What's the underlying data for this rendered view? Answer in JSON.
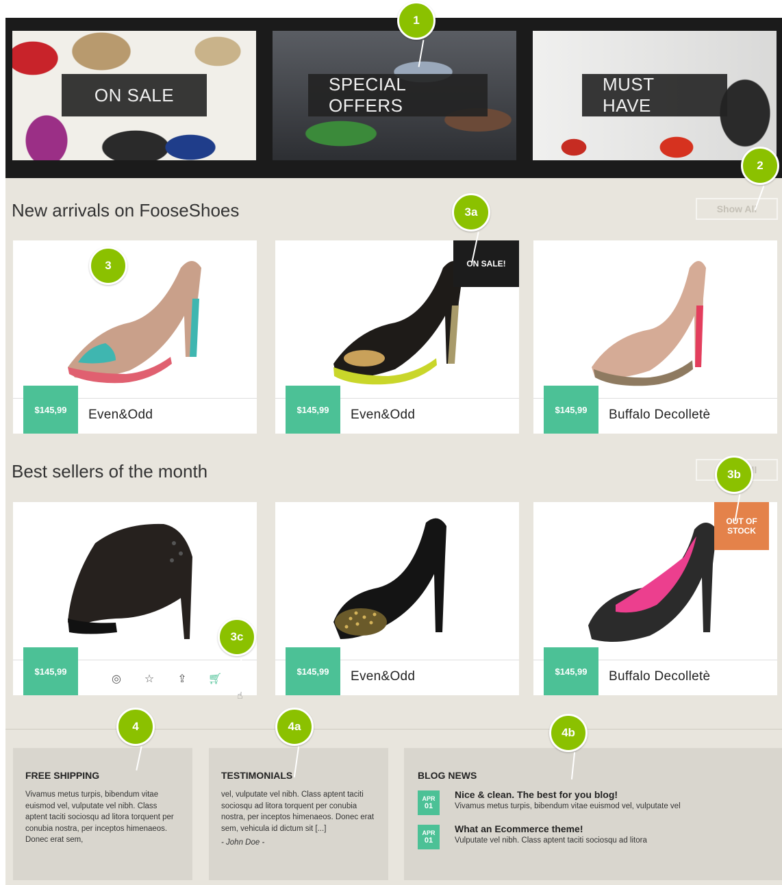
{
  "banners": [
    {
      "label": "ON SALE"
    },
    {
      "label": "SPECIAL OFFERS"
    },
    {
      "label": "MUST HAVE"
    }
  ],
  "new_arrivals": {
    "title": "New arrivals on FooseShoes",
    "show_all": "Show All",
    "products": [
      {
        "price": "$145,99",
        "name": "Even&Odd",
        "shoe_color": "#c9a08a",
        "accent": "#3fb6b0"
      },
      {
        "price": "$145,99",
        "name": "Even&Odd",
        "badge": "ON SALE!",
        "shoe_color": "#1e1b18",
        "accent": "#c9d62a"
      },
      {
        "price": "$145,99",
        "name": "Buffalo Decolletè",
        "shoe_color": "#d5ab96",
        "accent": "#e33e5d"
      }
    ]
  },
  "best_sellers": {
    "title": "Best sellers of the month",
    "show_all": "Show All",
    "products": [
      {
        "price": "$145,99",
        "name": "",
        "actions": [
          "eye-icon",
          "star-icon",
          "share-icon",
          "cart-icon"
        ],
        "shoe_color": "#26211e"
      },
      {
        "price": "$145,99",
        "name": "Even&Odd",
        "shoe_color": "#141414"
      },
      {
        "price": "$145,99",
        "name": "Buffalo Decolletè",
        "badge": "OUT OF STOCK",
        "shoe_color": "#2b2b2b",
        "accent": "#ec3f8e"
      }
    ]
  },
  "footer": {
    "free_shipping": {
      "title": "FREE SHIPPING",
      "text": "Vivamus metus turpis, bibendum vitae euismod vel, vulputate vel nibh. Class aptent taciti sociosqu ad litora torquent per conubia nostra, per inceptos himenaeos. Donec erat sem,"
    },
    "testimonials": {
      "title": "TESTIMONIALS",
      "text": "vel, vulputate vel nibh. Class aptent taciti sociosqu ad litora torquent per conubia nostra, per inceptos himenaeos. Donec erat sem, vehicula id dictum sit [...]",
      "author": "- John Doe -"
    },
    "blog": {
      "title": "BLOG NEWS",
      "posts": [
        {
          "month": "APR",
          "day": "01",
          "title": "Nice & clean. The best for you blog!",
          "excerpt": "Vivamus metus turpis, bibendum vitae euismod vel, vulputate vel"
        },
        {
          "month": "APR",
          "day": "01",
          "title": "What an Ecommerce theme!",
          "excerpt": "Vulputate vel nibh. Class aptent taciti sociosqu ad litora"
        }
      ]
    }
  },
  "annotations": [
    "1",
    "2",
    "3",
    "3a",
    "3b",
    "3c",
    "4",
    "4a",
    "4b"
  ],
  "colors": {
    "accent": "#4cc196",
    "pin": "#8bc100",
    "sale_badge": "#1c1c1c",
    "stock_badge": "#e4824a",
    "background": "#e8e5dd"
  }
}
